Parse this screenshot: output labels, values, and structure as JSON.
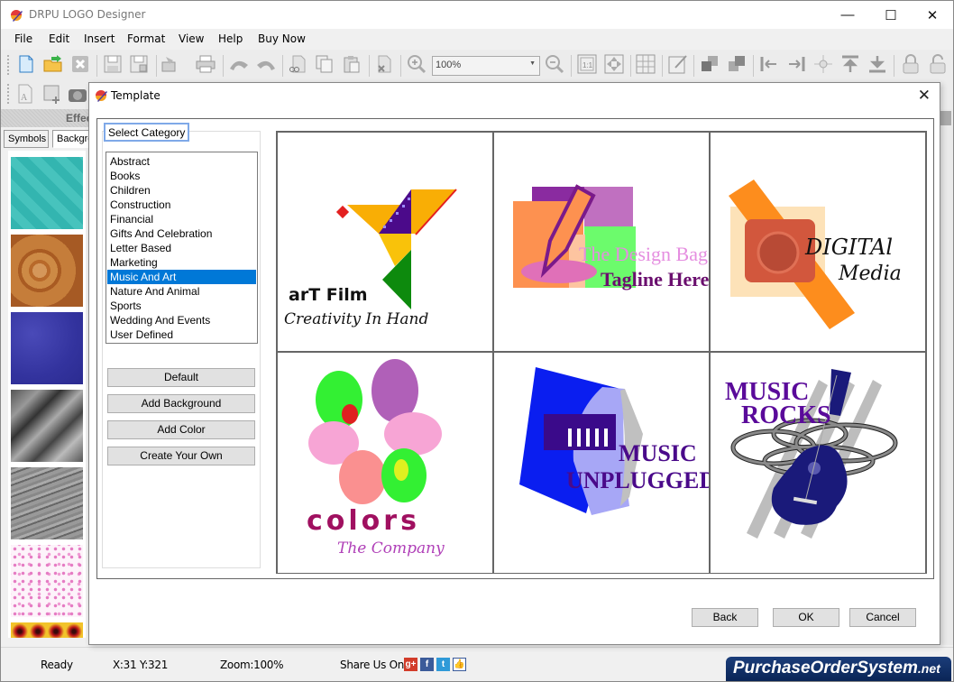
{
  "window": {
    "title": "DRPU LOGO Designer",
    "controls": {
      "minimize": "—",
      "maximize": "☐",
      "close": "✕"
    }
  },
  "menu": [
    "File",
    "Edit",
    "Insert",
    "Format",
    "View",
    "Help",
    "Buy Now"
  ],
  "toolbar": {
    "zoom_value": "100%",
    "icons": [
      "new-file-icon",
      "open-folder-icon",
      "close-file-icon",
      "save-icon",
      "save-as-icon",
      "export-icon",
      "print-icon",
      "undo-icon",
      "redo-icon",
      "cut-icon",
      "copy-icon",
      "paste-icon",
      "delete-icon",
      "zoom-in-icon",
      "zoom-out-icon",
      "actual-size-icon",
      "fit-window-icon",
      "grid-icon",
      "edit-icon",
      "bring-front-icon",
      "send-back-icon",
      "align-left-icon",
      "align-right-icon",
      "align-center-icon",
      "align-top-icon",
      "align-bottom-icon",
      "lock-icon",
      "unlock-icon"
    ]
  },
  "left_panel": {
    "header": "Effects",
    "tabs": [
      "Symbols",
      "Backgrounds"
    ],
    "active_tab": "Backgrounds"
  },
  "dialog": {
    "title": "Template",
    "close": "✕",
    "category_label": "Select Category",
    "categories": [
      "Abstract",
      "Books",
      "Children",
      "Construction",
      "Financial",
      "Gifts And Celebration",
      "Letter Based",
      "Marketing",
      "Music And Art",
      "Nature And Animal",
      "Sports",
      "Wedding And Events",
      "User Defined"
    ],
    "selected_category": "Music And Art",
    "side_buttons": [
      "Default",
      "Add Background",
      "Add Color",
      "Create Your Own"
    ],
    "templates": [
      {
        "title": "arT Film",
        "tagline": "Creativity In Hand"
      },
      {
        "title": "The Design Bag",
        "tagline": "Tagline Here"
      },
      {
        "title": "DIGITAl",
        "tagline": "Media"
      },
      {
        "title": "colors",
        "tagline": "The Company"
      },
      {
        "title": "MUSIC",
        "tagline": "UNPLUGGED"
      },
      {
        "title": "MUSIC",
        "tagline": "ROCKS"
      }
    ],
    "footer_buttons": {
      "back": "Back",
      "ok": "OK",
      "cancel": "Cancel"
    }
  },
  "status": {
    "state": "Ready",
    "coords": "X:31  Y:321",
    "zoom": "Zoom:100%",
    "share_label": "Share Us On:",
    "share_icons": [
      "google-plus-icon",
      "facebook-icon",
      "twitter-icon",
      "like-icon"
    ]
  },
  "branding": {
    "name": "PurchaseOrderSystem",
    "suffix": ".net"
  },
  "colors": {
    "selection": "#0078d7",
    "focus_border": "#7fa9e8",
    "brand_bg": "#0a2556"
  }
}
